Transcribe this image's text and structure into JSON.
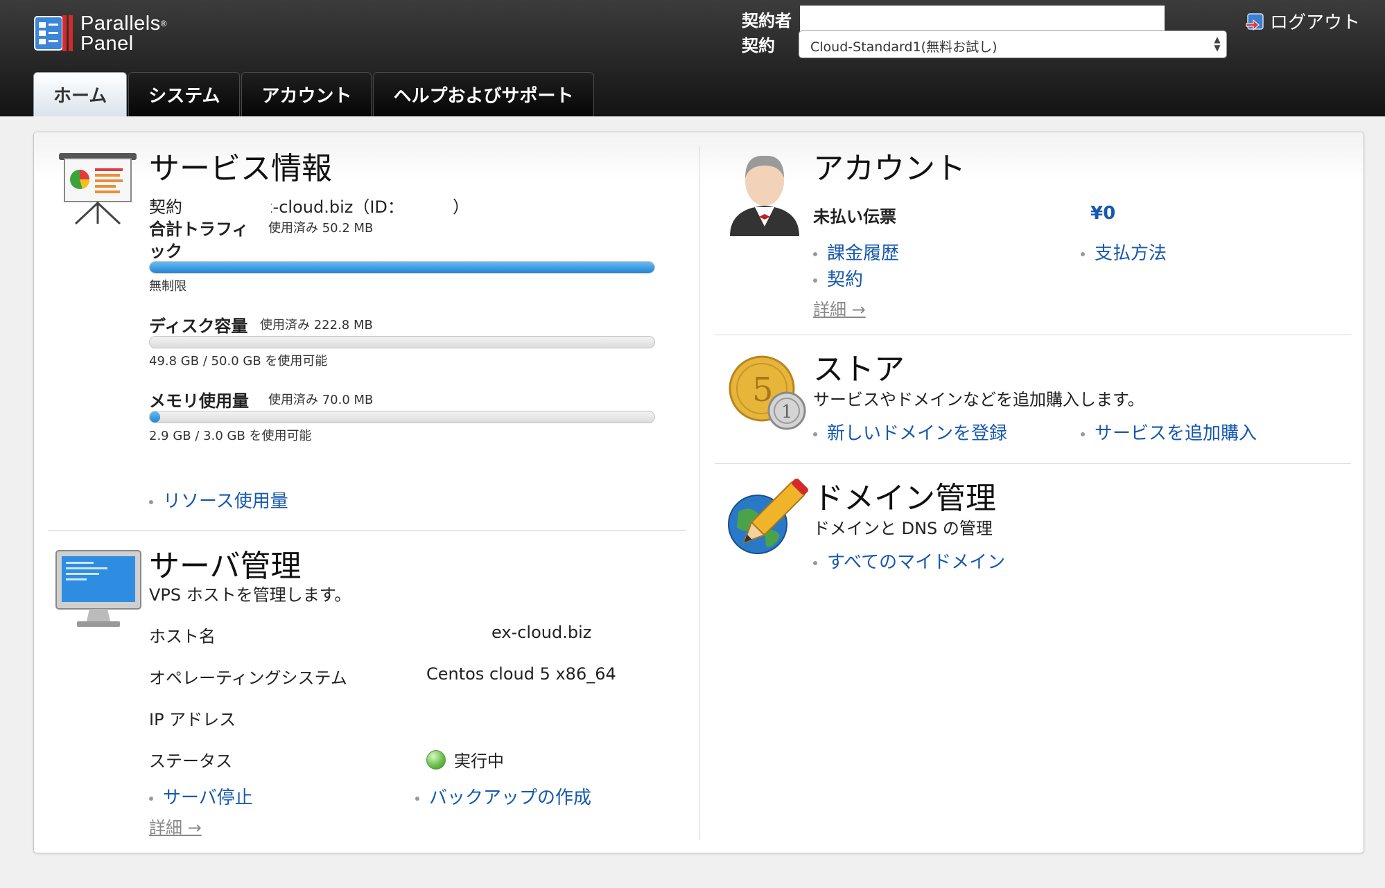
{
  "header": {
    "logo_line1": "Parallels",
    "logo_line2": "Panel",
    "logo_reg": "®",
    "owner_label": "契約者",
    "contract_label": "契約",
    "contract_selected": "Cloud-Standard1(無料お試し)",
    "logout_label": "ログアウト"
  },
  "tabs": [
    {
      "label": "ホーム",
      "active": true
    },
    {
      "label": "システム",
      "active": false
    },
    {
      "label": "アカウント",
      "active": false
    },
    {
      "label": "ヘルプおよびサポート",
      "active": false
    }
  ],
  "service": {
    "title": "サービス情報",
    "contract_label": "契約",
    "contract_value": "ex-cloud.biz（ID：",
    "contract_close": "）",
    "traffic_label": "合計トラフィ",
    "traffic_label2": "ック",
    "traffic_used": "使用済み 50.2 MB",
    "traffic_fill_fraction": 1.0,
    "traffic_available": "無制限",
    "disk_label": "ディスク容量",
    "disk_used": "使用済み 222.8 MB",
    "disk_fill_fraction": 0.0,
    "disk_available": "49.8 GB / 50.0 GB を使用可能",
    "memory_label": "メモリ使用量",
    "memory_used": "使用済み 70.0 MB",
    "memory_fill_fraction": 0.02,
    "memory_available": "2.9 GB / 3.0 GB を使用可能",
    "resource_link": "リソース使用量"
  },
  "server": {
    "title": "サーバ管理",
    "description": "VPS ホストを管理します。",
    "hostname_label": "ホスト名",
    "hostname_value": "ex-cloud.biz",
    "os_label": "オペレーティングシステム",
    "os_value": "Centos cloud 5 x86_64",
    "ip_label": "IP アドレス",
    "status_label": "ステータス",
    "status_value": "実行中",
    "stop_link": "サーバ停止",
    "backup_link": "バックアップの作成",
    "more_link": "詳細 →"
  },
  "account": {
    "title": "アカウント",
    "unpaid_label": "未払い伝票",
    "unpaid_value": "¥0",
    "billing_link": "課金履歴",
    "payment_link": "支払方法",
    "contract_link": "契約",
    "more_link": "詳細 →"
  },
  "store": {
    "title": "ストア",
    "description": "サービスやドメインなどを追加購入します。",
    "new_domain_link": "新しいドメインを登録",
    "add_service_link": "サービスを追加購入"
  },
  "domain": {
    "title": "ドメイン管理",
    "description": "ドメインと DNS の管理",
    "all_domains_link": "すべてのマイドメイン"
  }
}
